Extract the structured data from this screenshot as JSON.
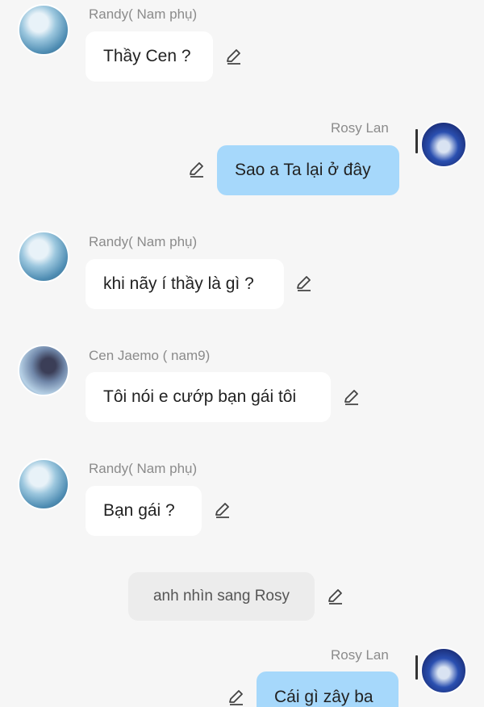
{
  "messages": [
    {
      "speaker": "Randy( Nam phụ)",
      "text": "Thầy Cen ?",
      "side": "left",
      "avatar": "randy-avatar"
    },
    {
      "speaker": "Rosy Lan",
      "text": "Sao a Ta lại ở đây",
      "side": "right",
      "avatar": "rosy-avatar"
    },
    {
      "speaker": "Randy( Nam phụ)",
      "text": "khi nãy í thầy là gì ?",
      "side": "left",
      "avatar": "randy-avatar"
    },
    {
      "speaker": "Cen Jaemo ( nam9)",
      "text": "Tôi nói e cướp bạn gái tôi",
      "side": "left",
      "avatar": "cen-avatar"
    },
    {
      "speaker": "Randy( Nam phụ)",
      "text": "Bạn gái ?",
      "side": "left",
      "avatar": "randy-avatar"
    },
    {
      "speaker": "",
      "text": "anh nhìn sang Rosy",
      "side": "narration"
    },
    {
      "speaker": "Rosy Lan",
      "text": "Cái gì zây ba",
      "side": "right",
      "avatar": "rosy-avatar"
    }
  ],
  "colors": {
    "background": "#f6f6f6",
    "left_bubble": "#ffffff",
    "right_bubble": "#a6d8fb",
    "narration_bubble": "#ececec",
    "name_text": "#8b8b8b"
  },
  "icons": {
    "edit": "pencil-edit-icon"
  }
}
